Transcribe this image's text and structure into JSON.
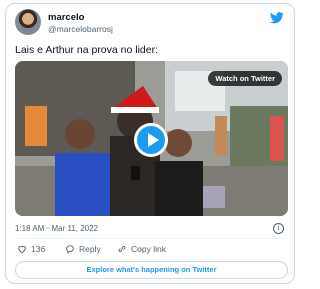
{
  "author": {
    "name": "marcelo",
    "handle": "@marcelobarrosj"
  },
  "tweet": {
    "text": "Lais e Arthur na prova no lider:",
    "timestamp": "1:18 AM · Mar 11, 2022"
  },
  "media": {
    "watch_label": "Watch on Twitter"
  },
  "actions": {
    "likes": "136",
    "reply_label": "Reply",
    "copy_label": "Copy link"
  },
  "footer": {
    "explore_label": "Explore what's happening on Twitter"
  },
  "icons": {
    "brand": "twitter-bird-icon",
    "play": "play-icon",
    "info": "info-icon",
    "like": "heart-icon",
    "reply": "reply-icon",
    "copy": "link-icon"
  },
  "colors": {
    "accent": "#1d9bf0",
    "text": "#0f1419",
    "muted": "#536471",
    "border": "#cfd9de"
  }
}
